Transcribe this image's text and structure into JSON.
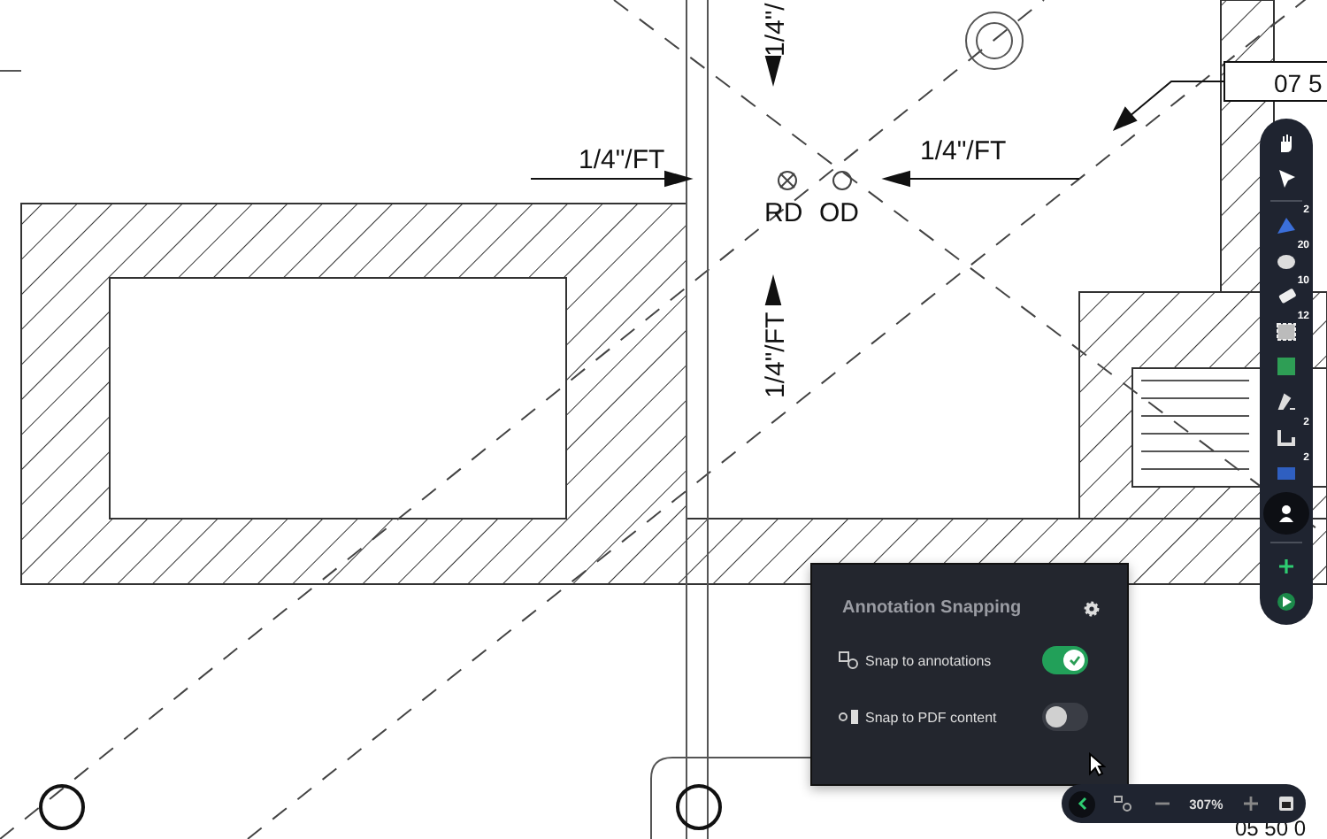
{
  "drawing": {
    "labels": [
      {
        "text": "1/4\"/FT",
        "kind": "horizontal"
      },
      {
        "text": "1/4\"/FT",
        "kind": "horizontal"
      },
      {
        "text": "1/4\"/",
        "kind": "vertical"
      },
      {
        "text": "1/4\"/FT",
        "kind": "vertical"
      },
      {
        "text": "RD",
        "kind": "horizontal"
      },
      {
        "text": "OD",
        "kind": "horizontal"
      }
    ],
    "tag": "07 5",
    "bottom_tag": "05 50 0"
  },
  "toolbar": {
    "tools": [
      {
        "kind": "hand",
        "selected": false
      },
      {
        "kind": "pointer",
        "selected": false
      },
      {
        "kind": "divider"
      },
      {
        "kind": "pin",
        "count": "2",
        "selected": false
      },
      {
        "kind": "cloud",
        "count": "20",
        "selected": false
      },
      {
        "kind": "eraser",
        "count": "10",
        "selected": false
      },
      {
        "kind": "pattern",
        "count": "12",
        "selected": false
      },
      {
        "kind": "square",
        "selected": false
      },
      {
        "kind": "pen",
        "selected": false
      },
      {
        "kind": "shape",
        "count": "2",
        "selected": false
      },
      {
        "kind": "block",
        "count": "2",
        "selected": false
      },
      {
        "kind": "person",
        "selected": true
      },
      {
        "kind": "divider"
      },
      {
        "kind": "plus",
        "selected": false
      },
      {
        "kind": "arrow",
        "selected": false
      }
    ]
  },
  "snapping": {
    "title": "Annotation Snapping",
    "options": [
      {
        "kind": "annotations",
        "label": "Snap to annotations",
        "on": true
      },
      {
        "kind": "pdf",
        "label": "Snap to PDF content",
        "on": false
      }
    ]
  },
  "zoom": {
    "value": "307%"
  }
}
